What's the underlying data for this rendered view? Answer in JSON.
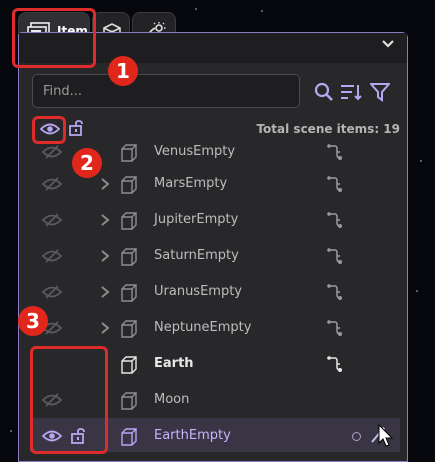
{
  "tabs": [
    {
      "label": "Item",
      "icon": "item-icon",
      "active": true
    },
    {
      "label": "",
      "icon": "object-icon"
    },
    {
      "label": "",
      "icon": "scene-icon"
    }
  ],
  "search": {
    "placeholder": "Find..."
  },
  "toolbar": {
    "search_icon": "search-icon",
    "sort_icon": "sort-icon",
    "filter_icon": "filter-icon"
  },
  "summary": {
    "total_label": "Total scene items: 19"
  },
  "items": [
    {
      "name": "VenusEmpty",
      "has_children": false
    },
    {
      "name": "MarsEmpty",
      "has_children": true
    },
    {
      "name": "JupiterEmpty",
      "has_children": true
    },
    {
      "name": "SaturnEmpty",
      "has_children": true
    },
    {
      "name": "UranusEmpty",
      "has_children": true
    },
    {
      "name": "NeptuneEmpty",
      "has_children": true
    },
    {
      "name": "Earth",
      "has_children": false
    },
    {
      "name": "Moon",
      "has_children": false
    },
    {
      "name": "EarthEmpty",
      "has_children": false
    }
  ],
  "annotations": [
    "1",
    "2",
    "3"
  ],
  "colors": {
    "accent": "#8b7ac2",
    "annotation": "#e1261c"
  }
}
